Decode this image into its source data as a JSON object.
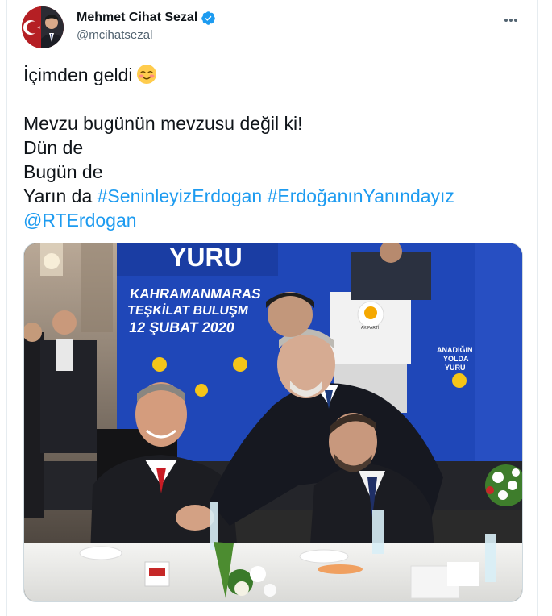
{
  "tweet": {
    "author": {
      "display_name": "Mehmet Cihat Sezal",
      "handle": "@mcihatsezal",
      "verified": true,
      "avatar_icon": "profile-avatar"
    },
    "more_icon": "more-horizontal-icon",
    "text": {
      "line1": "İçimden geldi",
      "line1_emoji": "smiling-face-with-blush-emoji",
      "line2": "Mevzu bugünün mevzusu değil ki!",
      "line3": "Dün de",
      "line4": "Bugün de",
      "line5_prefix": "Yarın da",
      "hashtag1": "#SeninleyizErdogan",
      "hashtag2": "#ErdoğanınYanındayız",
      "mention": "@RTErdogan"
    },
    "photo": {
      "banner_top": "YURU",
      "banner_city": "KAHRAMANMARAS",
      "banner_event": "TEŞKİLAT BULUŞM",
      "banner_date": "12 ŞUBAT 2020",
      "side_line1": "ANADIĞIN",
      "side_line2": "YOLDA",
      "side_line3": "YURU",
      "podium_label": "AK PARTİ"
    }
  },
  "colors": {
    "link": "#1d9bf0",
    "verified": "#1d9bf0",
    "text": "#0f1419",
    "secondary": "#536471",
    "banner_blue": "#1f47b8"
  }
}
